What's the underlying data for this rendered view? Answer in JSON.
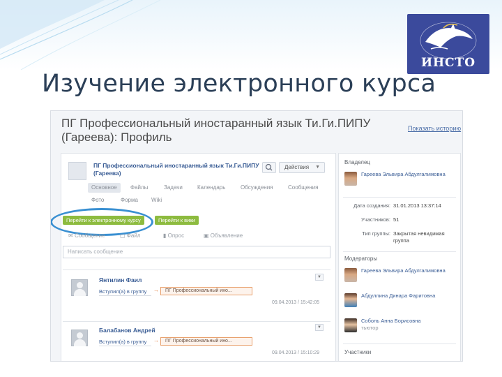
{
  "slide": {
    "title": "Изучение электронного курса",
    "logo_text": "ИНСТО"
  },
  "page": {
    "title": "ПГ Профессиональный иностаранный язык Ти.Ги.ПИПУ (Гареева): Профиль",
    "history_link": "Показать историю"
  },
  "group": {
    "name": "ПГ Профессиональный иностаранный язык Ти.Ги.ПИПУ (Гареева)",
    "action_label": "Действия",
    "tabs": [
      "Основное",
      "Файлы",
      "Задачи",
      "Календарь",
      "Обсуждения",
      "Сообщения"
    ],
    "tabs2": [
      "Фото",
      "Форма",
      "Wiki"
    ],
    "buttons": [
      "Перейти к электронному курсу",
      "Перейти к вики"
    ]
  },
  "post": {
    "tabs": [
      "Сообщение",
      "Файл",
      "Опрос",
      "Объявление"
    ],
    "placeholder": "Написать сообщение"
  },
  "feed": [
    {
      "name": "Янтилин Фаил",
      "action": "Вступил(а) в группу",
      "course": "ПГ Профессиональный ино...",
      "time": "09.04.2013 / 15:42:05"
    },
    {
      "name": "Балабанов Андрей",
      "action": "Вступил(а) в группу",
      "course": "ПГ Профессиональный ино...",
      "time": "09.04.2013 / 15:10:29"
    }
  ],
  "sidebar": {
    "owner_heading": "Владелец",
    "owner": "Гареева Эльвира Абдулгалимовна",
    "info": [
      {
        "label": "Дата создания:",
        "value": "31.01.2013 13:37:14"
      },
      {
        "label": "Участников:",
        "value": "51"
      },
      {
        "label": "Тип группы:",
        "value": "Закрытая невидимая группа"
      }
    ],
    "moderators_heading": "Модераторы",
    "moderators": [
      "Гареева Эльвира Абдулгалимовна",
      "Абдуллина Динара Фаритовна",
      "Соболь Анна Борисовна"
    ],
    "moderator3_extra": "тьютор",
    "members_heading": "Участники"
  },
  "colors": {
    "slide_title": "#2b3f57",
    "link_blue": "#3a5d95",
    "button_green": "#8dbb3f",
    "highlight_circle": "#3a90d2",
    "logo_bg": "#3b4a9c"
  }
}
